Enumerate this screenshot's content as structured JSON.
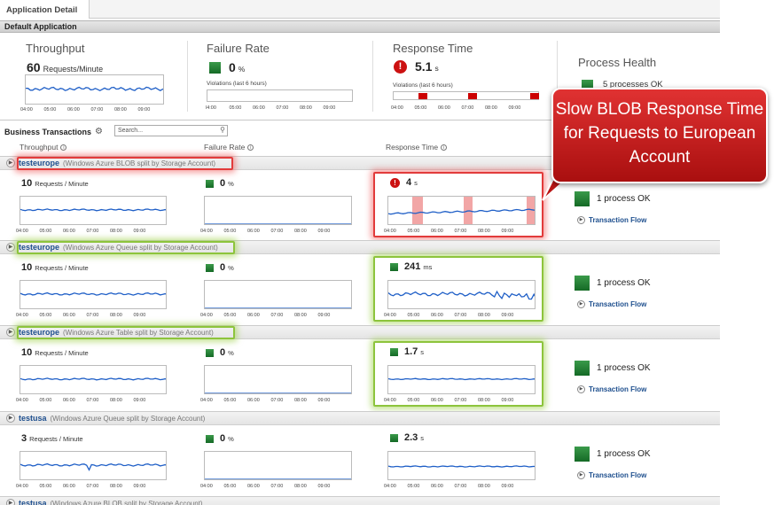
{
  "tabs": [
    "Application Detail"
  ],
  "section_title": "Default Application",
  "summary": {
    "throughput": {
      "title": "Throughput",
      "value": "60",
      "unit": "Requests/Minute"
    },
    "failure": {
      "title": "Failure Rate",
      "value": "0",
      "unit": "%",
      "violations": "Violations (last 6 hours)"
    },
    "response": {
      "title": "Response Time",
      "value": "5.1",
      "unit": "s",
      "violations": "Violations (last 6 hours)"
    },
    "health": {
      "title": "Process Health",
      "status": "5 processes OK"
    }
  },
  "time_ticks": [
    "04:00",
    "05:00",
    "06:00",
    "07:00",
    "08:00",
    "09:00"
  ],
  "time_ticks_short": [
    "l4:00",
    "05:00",
    "06:00",
    "07:00",
    "08:00",
    "09:00"
  ],
  "bt": {
    "title": "Business Transactions",
    "search_placeholder": "Search...",
    "col_throughput": "Throughput",
    "col_failure": "Failure Rate",
    "col_response": "Response Time"
  },
  "rows": [
    {
      "name": "testeurope",
      "sub": "(Windows Azure BLOB split by Storage Account)",
      "tp": "10",
      "tp_unit": "Requests / Minute",
      "fr": "0",
      "fr_unit": "%",
      "rt": "4",
      "rt_unit": "s",
      "rt_status": "error",
      "health": "1 process OK",
      "flow": "Transaction Flow",
      "highlight": "red"
    },
    {
      "name": "testeurope",
      "sub": "(Windows Azure Queue split by Storage Account)",
      "tp": "10",
      "tp_unit": "Requests / Minute",
      "fr": "0",
      "fr_unit": "%",
      "rt": "241",
      "rt_unit": "ms",
      "rt_status": "ok",
      "health": "1 process OK",
      "flow": "Transaction Flow",
      "highlight": "green"
    },
    {
      "name": "testeurope",
      "sub": "(Windows Azure Table split by Storage Account)",
      "tp": "10",
      "tp_unit": "Requests / Minute",
      "fr": "0",
      "fr_unit": "%",
      "rt": "1.7",
      "rt_unit": "s",
      "rt_status": "ok",
      "health": "1 process OK",
      "flow": "Transaction Flow",
      "highlight": "green"
    },
    {
      "name": "testusa",
      "sub": "(Windows Azure Queue split by Storage Account)",
      "tp": "3",
      "tp_unit": "Requests / Minute",
      "fr": "0",
      "fr_unit": "%",
      "rt": "2.3",
      "rt_unit": "s",
      "rt_status": "ok",
      "health": "1 process OK",
      "flow": "Transaction Flow",
      "highlight": "none"
    },
    {
      "name": "testusa",
      "sub": "(Windows Azure BLOB split by Storage Account)"
    }
  ],
  "callout": {
    "text": "Slow BLOB Response Time for Requests to European Account"
  },
  "colors": {
    "ok": "#1f7a30",
    "error": "#cc1111",
    "link": "#1e4f8e",
    "line": "#1f5fc7",
    "callout": "#cc1f1f"
  }
}
